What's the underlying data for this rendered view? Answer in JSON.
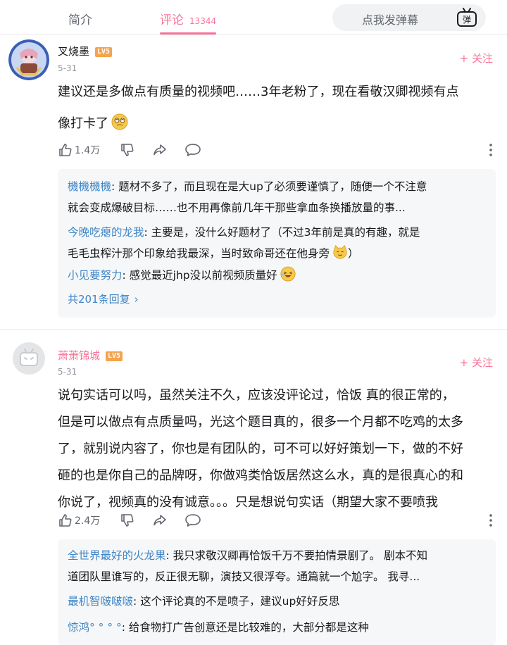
{
  "tabs": {
    "intro": "简介",
    "comments": "评论",
    "comment_count": "13344"
  },
  "danmaku": {
    "placeholder": "点我发弹幕",
    "icon_text": "弹"
  },
  "comments": [
    {
      "username": "叉烧墨",
      "level": "LV5",
      "date": "5-31",
      "follow_label": "+ 关注",
      "content_line1": "建议还是多做点有质量的视频吧……3年老粉了，现在看敬汉卿视频有点",
      "content_line2": "像打卡了",
      "likes": "1.4万",
      "replies": [
        {
          "user": "機機機機",
          "text": ": 题材不多了，而且现在是大up了必须要谨慎了，随便一个不注意",
          "text2": "就会变成爆破目标……也不用再像前几年干那些拿血条换播放量的事..."
        },
        {
          "user": "今晚吃瘪的龙我",
          "text": ": 主要是，没什么好题材了（不过3年前是真的有趣，就是",
          "text2": "毛毛虫榨汁那个印象给我最深，当时致命哥还在他身旁",
          "text3": "）"
        },
        {
          "user": "小见要努力",
          "text": ": 感觉最近jhp没以前视频质量好"
        }
      ],
      "all_replies": "共201条回复"
    },
    {
      "username": "萧萧锦城",
      "level": "LV5",
      "date": "5-31",
      "follow_label": "+ 关注",
      "content_lines": [
        "说句实话可以吗，虽然关注不久，应该没评论过，恰饭 真的很正常的，",
        "但是可以做点有点质量吗，光这个题目真的，很多一个月都不吃鸡的太多",
        "了，就别说内容了，你也是有团队的，可不可以好好策划一下，做的不好",
        "砸的也是你自己的品牌呀，你做鸡类恰饭居然这么水，真的是很真心的和",
        "你说了，视频真的没有诚意。。。只是想说句实话（期望大家不要喷我"
      ],
      "likes": "2.4万",
      "replies": [
        {
          "user": "全世界最好的火龙果",
          "text": ": 我只求敬汉卿再恰饭千万不要拍情景剧了。 剧本不知",
          "text2": "道团队里谁写的，反正很无聊，演技又很浮夸。通篇就一个尬字。 我寻..."
        },
        {
          "user": "最机智啵啵啵",
          "text": ": 这个评论真的不是喷子，建议up好好反思"
        },
        {
          "user": "惊鸿°  °  °  °",
          "text": ": 给食物打广告创意还是比较难的，大部分都是这种"
        }
      ]
    }
  ],
  "colors": {
    "accent": "#fb7299",
    "link": "#3f86c6",
    "level_badge": "#f6a34e"
  }
}
